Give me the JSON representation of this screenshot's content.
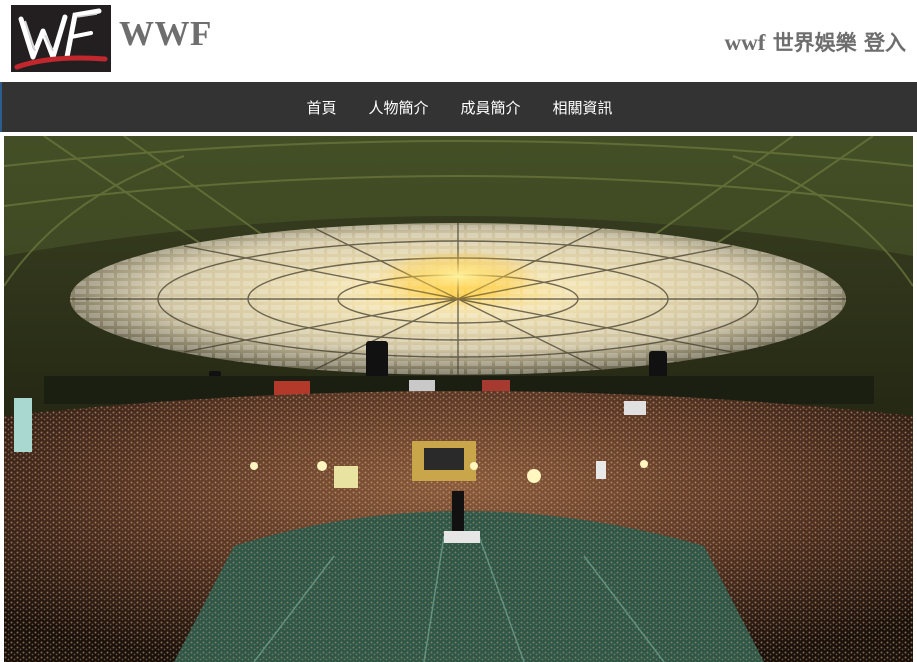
{
  "header": {
    "logo_alt": "WF",
    "brand": "WWF",
    "login_latin": "wwf",
    "login_text": "世界娛樂 登入"
  },
  "nav": {
    "items": [
      {
        "label": "首頁"
      },
      {
        "label": "人物簡介"
      },
      {
        "label": "成員簡介"
      },
      {
        "label": "相關資訊"
      }
    ]
  },
  "hero": {
    "description": "arena-photo"
  },
  "colors": {
    "nav_bg": "#333333",
    "brand_gray": "#6e6e6e",
    "logo_bg": "#231f20",
    "logo_red": "#c1272d"
  }
}
